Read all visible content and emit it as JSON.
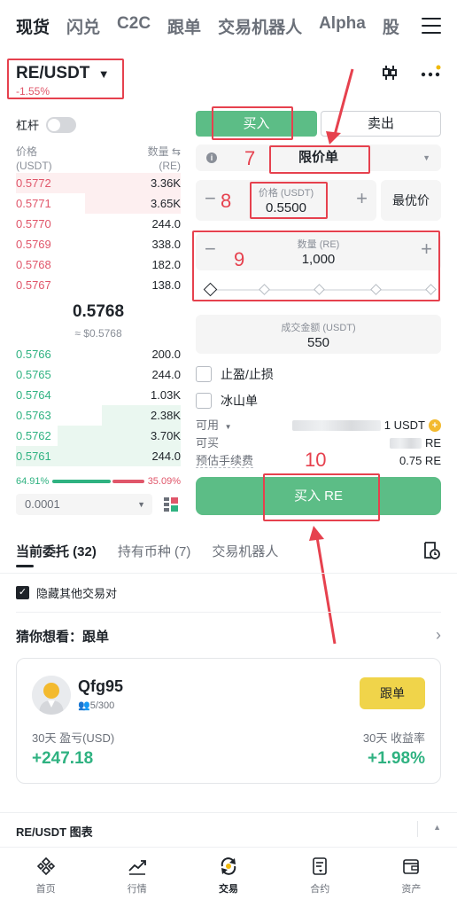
{
  "top_tabs": [
    "现货",
    "闪兑",
    "C2C",
    "跟单",
    "交易机器人",
    "Alpha",
    "股"
  ],
  "pair": {
    "symbol": "RE/USDT",
    "change": "-1.55%"
  },
  "leverage_label": "杠杆",
  "orderbook": {
    "price_header": "价格",
    "price_unit": "(USDT)",
    "qty_header": "数量",
    "qty_unit": "(RE)",
    "asks": [
      {
        "price": "0.5772",
        "qty": "3.36K",
        "depth": 1.0
      },
      {
        "price": "0.5771",
        "qty": "3.65K",
        "depth": 0.58
      },
      {
        "price": "0.5770",
        "qty": "244.0",
        "depth": 0.0
      },
      {
        "price": "0.5769",
        "qty": "338.0",
        "depth": 0.0
      },
      {
        "price": "0.5768",
        "qty": "182.0",
        "depth": 0.0
      },
      {
        "price": "0.5767",
        "qty": "138.0",
        "depth": 0.0
      }
    ],
    "last_price": "0.5768",
    "last_price_usd": "≈ $0.5768",
    "bids": [
      {
        "price": "0.5766",
        "qty": "200.0",
        "depth": 0.0
      },
      {
        "price": "0.5765",
        "qty": "244.0",
        "depth": 0.0
      },
      {
        "price": "0.5764",
        "qty": "1.03K",
        "depth": 0.0
      },
      {
        "price": "0.5763",
        "qty": "2.38K",
        "depth": 0.48
      },
      {
        "price": "0.5762",
        "qty": "3.70K",
        "depth": 0.75
      },
      {
        "price": "0.5761",
        "qty": "244.0",
        "depth": 1.0
      }
    ],
    "buy_ratio": "64.91%",
    "sell_ratio": "35.09%",
    "precision": "0.0001"
  },
  "order_form": {
    "buy_tab": "买入",
    "sell_tab": "卖出",
    "order_type": "限价单",
    "price_label": "价格 (USDT)",
    "price_value": "0.5500",
    "best_price_label": "最优价",
    "qty_label": "数量 (RE)",
    "qty_value": "1,000",
    "amount_label": "成交金额 (USDT)",
    "amount_value": "550",
    "tp_sl_label": "止盈/止损",
    "iceberg_label": "冰山单",
    "available_label": "可用",
    "available_value": "1 USDT",
    "can_buy_label": "可买",
    "can_buy_value": "RE",
    "fee_label": "预估手续费",
    "fee_value": "0.75 RE",
    "buy_button": "买入 RE"
  },
  "annotations": [
    "7",
    "8",
    "9",
    "10"
  ],
  "lower": {
    "tabs": [
      "当前委托 (32)",
      "持有币种 (7)",
      "交易机器人"
    ],
    "hide_others": "隐藏其他交易对",
    "guess_title": "猜你想看：跟单"
  },
  "trader_card": {
    "name": "Qfg95",
    "followers": "5/300",
    "follow_button": "跟单",
    "pnl_label": "30天 盈亏(USD)",
    "pnl_value": "+247.18",
    "roi_label": "30天 收益率",
    "roi_value": "+1.98%"
  },
  "chart_label": "RE/USDT 图表",
  "nav": [
    "首页",
    "行情",
    "交易",
    "合约",
    "资产"
  ],
  "colors": {
    "buy": "#5cbd86",
    "sell": "#e0566a",
    "annotation": "#e6414e",
    "follow": "#f0d44a"
  }
}
